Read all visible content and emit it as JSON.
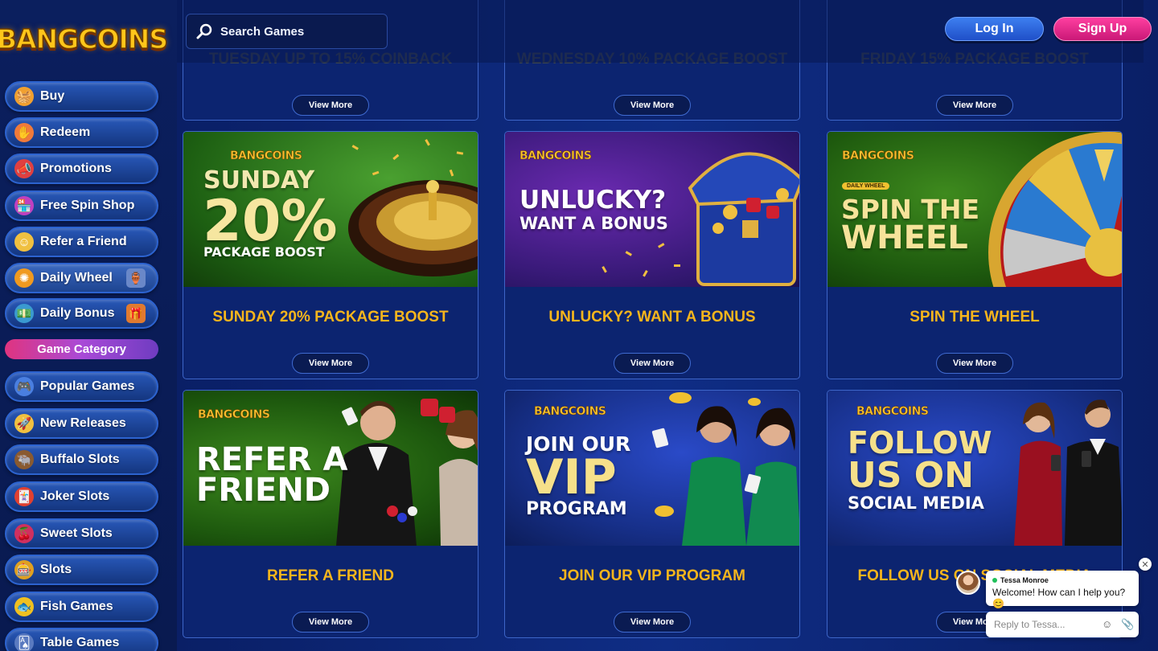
{
  "brand": {
    "logo_text": "BANGCOINS"
  },
  "search": {
    "placeholder": "Search Games"
  },
  "auth": {
    "login_label": "Log In",
    "signup_label": "Sign Up"
  },
  "sidebar": {
    "items": [
      {
        "label": "Buy",
        "icon": "basket-icon"
      },
      {
        "label": "Redeem",
        "icon": "hand-coin-icon"
      },
      {
        "label": "Promotions",
        "icon": "megaphone-icon"
      },
      {
        "label": "Free Spin Shop",
        "icon": "shop-icon"
      },
      {
        "label": "Refer a Friend",
        "icon": "friend-icon"
      },
      {
        "label": "Daily Wheel",
        "icon": "wheel-icon"
      },
      {
        "label": "Daily Bonus",
        "icon": "bonus-icon"
      }
    ],
    "category_header": "Game Category",
    "categories": [
      {
        "label": "Popular Games",
        "icon": "gamepad-icon"
      },
      {
        "label": "New Releases",
        "icon": "rocket-icon"
      },
      {
        "label": "Buffalo Slots",
        "icon": "buffalo-icon"
      },
      {
        "label": "Joker Slots",
        "icon": "joker-icon"
      },
      {
        "label": "Sweet Slots",
        "icon": "cherry-icon"
      },
      {
        "label": "Slots",
        "icon": "slot-machine-icon"
      },
      {
        "label": "Fish Games",
        "icon": "fish-icon"
      },
      {
        "label": "Table Games",
        "icon": "cards-icon"
      }
    ]
  },
  "promos": {
    "view_more": "View More",
    "top_row": [
      {
        "title": "TUESDAY UP TO 15% COINBACK"
      },
      {
        "title": "WEDNESDAY 10% PACKAGE BOOST"
      },
      {
        "title": "FRIDAY 15% PACKAGE BOOST"
      }
    ],
    "cards": [
      {
        "title": "SUNDAY 20% PACKAGE BOOST",
        "banner": {
          "brand": "BANGCOINS",
          "line1": "SUNDAY",
          "line2": "20%",
          "line3": "PACKAGE BOOST"
        }
      },
      {
        "title": "UNLUCKY? WANT A BONUS",
        "banner": {
          "brand": "BANGCOINS",
          "line1": "UNLUCKY?",
          "line2": "WANT A BONUS"
        }
      },
      {
        "title": "SPIN THE WHEEL",
        "banner": {
          "brand": "BANGCOINS",
          "tag": "DAILY WHEEL",
          "line1": "SPIN THE",
          "line2": "WHEEL"
        }
      },
      {
        "title": "REFER A FRIEND",
        "banner": {
          "brand": "BANGCOINS",
          "line1": "REFER A",
          "line2": "FRIEND"
        }
      },
      {
        "title": "JOIN OUR VIP PROGRAM",
        "banner": {
          "brand": "BANGCOINS",
          "line1": "JOIN OUR",
          "line2": "VIP",
          "line3": "PROGRAM"
        }
      },
      {
        "title": "FOLLOW US ON SOCIAL MEDIA",
        "banner": {
          "brand": "BANGCOINS",
          "line1": "FOLLOW",
          "line2": "US ON",
          "line3": "SOCIAL MEDIA"
        }
      }
    ]
  },
  "chat": {
    "agent_name": "Tessa Monroe",
    "message": "Welcome! How can I help you? 😊",
    "reply_placeholder": "Reply to Tessa...",
    "close_glyph": "✕"
  }
}
